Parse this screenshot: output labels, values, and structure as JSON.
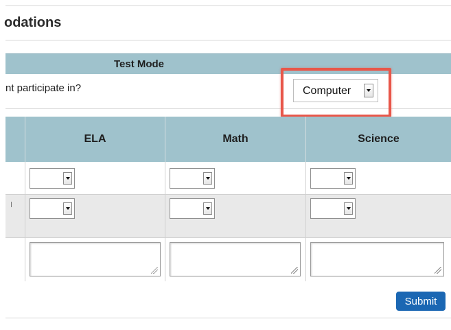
{
  "section": {
    "title": "odations"
  },
  "test_mode": {
    "header": "Test Mode",
    "question": "nt participate in?",
    "selected": "Computer"
  },
  "subjects": {
    "columns": [
      "ELA",
      "Math",
      "Science"
    ],
    "row_label_fragment": "l"
  },
  "actions": {
    "submit_label": "Submit"
  }
}
